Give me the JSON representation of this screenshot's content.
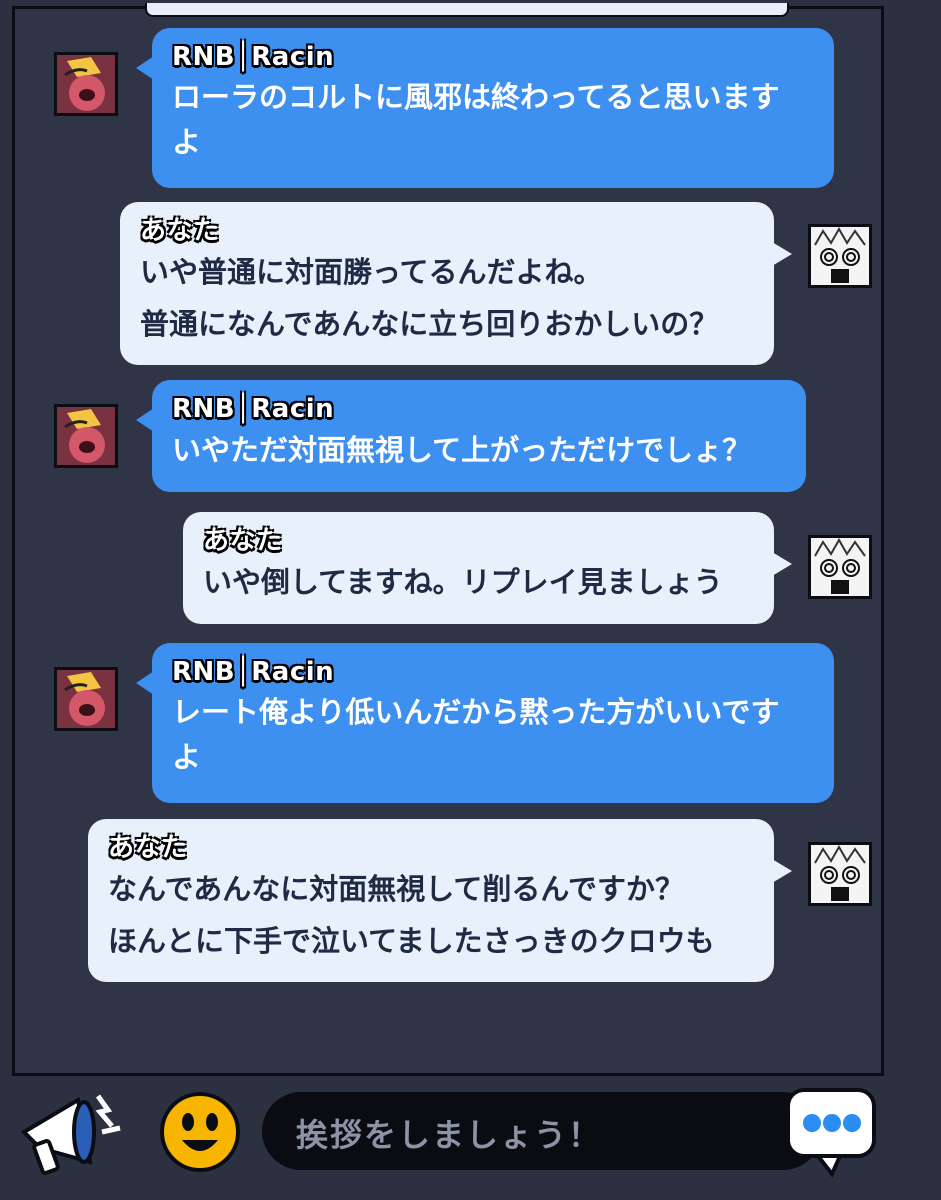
{
  "messages": [
    {
      "side": "other",
      "sender": "RNB│Racin",
      "text": "ローラのコルトに風邪は終わってると思いますよ",
      "lines": [
        "ローラのコルトに風邪は終わってると思います",
        "よ"
      ]
    },
    {
      "side": "me",
      "sender": "あなた",
      "text": "いや普通に対面勝ってるんだよね。普通になんであんなに立ち回りおかしいの？",
      "lines": [
        "いや普通に対面勝ってるんだよね。",
        "普通になんであんなに立ち回りおかしいの？"
      ]
    },
    {
      "side": "other",
      "sender": "RNB│Racin",
      "text": "いやただ対面無視して上がっただけでしょ？",
      "lines": [
        "いやただ対面無視して上がっただけでしょ？"
      ]
    },
    {
      "side": "me",
      "sender": "あなた",
      "text": "いや倒してますね。リプレイ見ましょう",
      "lines": [
        "いや倒してますね。リプレイ見ましょう"
      ]
    },
    {
      "side": "other",
      "sender": "RNB│Racin",
      "text": "レート俺より低いんだから黙った方がいいですよ",
      "lines": [
        "レート俺より低いんだから黙った方がいいです",
        "よ"
      ]
    },
    {
      "side": "me",
      "sender": "あなた",
      "text": "なんであんなに対面無視して削るんですか？ほんとに下手で泣いてましたさっきのクロウも",
      "lines": [
        "なんであんなに対面無視して削るんですか？",
        "ほんとに下手で泣いてましたさっきのクロウも"
      ]
    }
  ],
  "input": {
    "placeholder": "挨拶をしましょう！"
  },
  "icons": {
    "megaphone": "megaphone-icon",
    "emoji": "emoji-icon",
    "send": "chat-send-icon"
  },
  "colors": {
    "other_bubble": "#3d8ff0",
    "my_bubble": "#e7f0fb",
    "background": "#2c3142"
  }
}
